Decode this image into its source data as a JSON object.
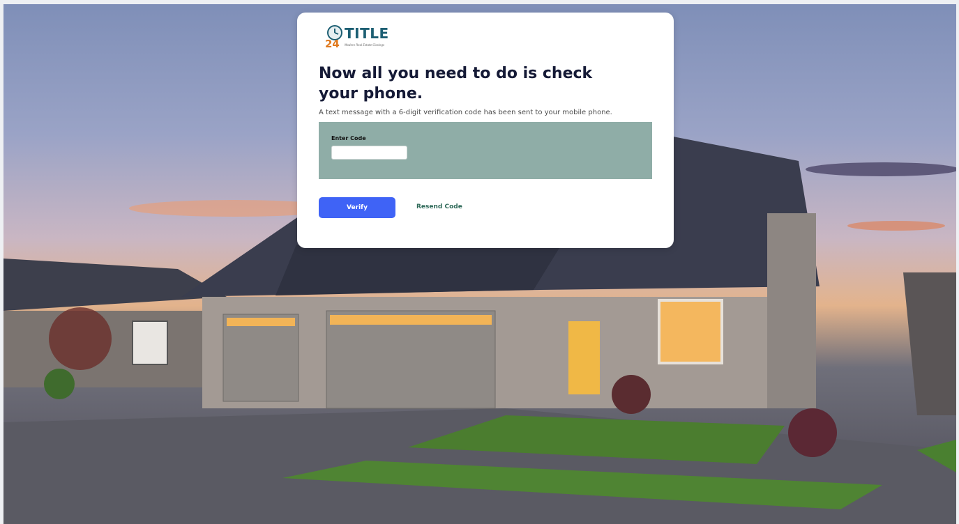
{
  "logo": {
    "brand": "TITLE",
    "number": "24",
    "tagline": "Modern Real Estate Closings"
  },
  "heading": "Now all you need to do is check your phone.",
  "subtext": "A text message with a 6-digit verification code has been sent to your mobile phone.",
  "code_form": {
    "label": "Enter Code",
    "value": "",
    "placeholder": ""
  },
  "actions": {
    "verify_label": "Verify",
    "resend_label": "Resend Code"
  },
  "colors": {
    "accent": "#3f63f6",
    "panel": "#8fada7",
    "link": "#2f6a59",
    "heading": "#151a36"
  }
}
